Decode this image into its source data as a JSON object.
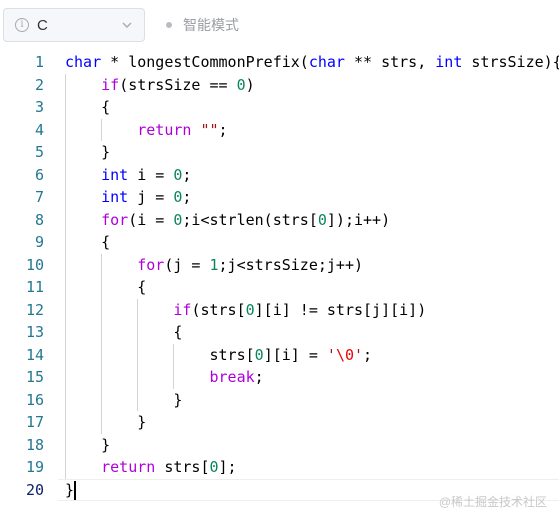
{
  "toolbar": {
    "language": "C",
    "mode_label": "智能模式"
  },
  "editor": {
    "line_numbers": [
      "1",
      "2",
      "3",
      "4",
      "5",
      "6",
      "7",
      "8",
      "9",
      "10",
      "11",
      "12",
      "13",
      "14",
      "15",
      "16",
      "17",
      "18",
      "19",
      "20"
    ],
    "active_line": 20,
    "lines": [
      [
        {
          "t": "char",
          "c": "kw"
        },
        {
          "t": " * longestCommonPrefix("
        },
        {
          "t": "char",
          "c": "kw"
        },
        {
          "t": " ** strs, "
        },
        {
          "t": "int",
          "c": "kw"
        },
        {
          "t": " strsSize){"
        }
      ],
      [
        {
          "t": "    "
        },
        {
          "t": "if",
          "c": "ctl"
        },
        {
          "t": "(strsSize == "
        },
        {
          "t": "0",
          "c": "num"
        },
        {
          "t": ")"
        }
      ],
      [
        {
          "t": "    {"
        }
      ],
      [
        {
          "t": "        "
        },
        {
          "t": "return",
          "c": "ctl"
        },
        {
          "t": " "
        },
        {
          "t": "\"\"",
          "c": "str"
        },
        {
          "t": ";"
        }
      ],
      [
        {
          "t": "    }"
        }
      ],
      [
        {
          "t": "    "
        },
        {
          "t": "int",
          "c": "kw"
        },
        {
          "t": " i = "
        },
        {
          "t": "0",
          "c": "num"
        },
        {
          "t": ";"
        }
      ],
      [
        {
          "t": "    "
        },
        {
          "t": "int",
          "c": "kw"
        },
        {
          "t": " j = "
        },
        {
          "t": "0",
          "c": "num"
        },
        {
          "t": ";"
        }
      ],
      [
        {
          "t": "    "
        },
        {
          "t": "for",
          "c": "ctl"
        },
        {
          "t": "(i = "
        },
        {
          "t": "0",
          "c": "num"
        },
        {
          "t": ";i<strlen(strs["
        },
        {
          "t": "0",
          "c": "num"
        },
        {
          "t": "]);i++)"
        }
      ],
      [
        {
          "t": "    {"
        }
      ],
      [
        {
          "t": "        "
        },
        {
          "t": "for",
          "c": "ctl"
        },
        {
          "t": "(j = "
        },
        {
          "t": "1",
          "c": "num"
        },
        {
          "t": ";j<strsSize;j++)"
        }
      ],
      [
        {
          "t": "        {"
        }
      ],
      [
        {
          "t": "            "
        },
        {
          "t": "if",
          "c": "ctl"
        },
        {
          "t": "(strs["
        },
        {
          "t": "0",
          "c": "num"
        },
        {
          "t": "][i] != strs[j][i])"
        }
      ],
      [
        {
          "t": "            {"
        }
      ],
      [
        {
          "t": "                strs["
        },
        {
          "t": "0",
          "c": "num"
        },
        {
          "t": "][i] = "
        },
        {
          "t": "'",
          "c": "str"
        },
        {
          "t": "\\0",
          "c": "esc"
        },
        {
          "t": "'",
          "c": "str"
        },
        {
          "t": ";"
        }
      ],
      [
        {
          "t": "                "
        },
        {
          "t": "break",
          "c": "ctl"
        },
        {
          "t": ";"
        }
      ],
      [
        {
          "t": "            }"
        }
      ],
      [
        {
          "t": "        }"
        }
      ],
      [
        {
          "t": "    }"
        }
      ],
      [
        {
          "t": "    "
        },
        {
          "t": "return",
          "c": "ctl"
        },
        {
          "t": " strs["
        },
        {
          "t": "0",
          "c": "num"
        },
        {
          "t": "];"
        }
      ],
      [
        {
          "t": "}"
        }
      ]
    ]
  },
  "watermark": "@稀土掘金技术社区",
  "colors": {
    "keyword": "#0000ff",
    "control": "#af00db",
    "number": "#098658",
    "string": "#a31515",
    "escape": "#ee0000",
    "line_number": "#237893"
  }
}
